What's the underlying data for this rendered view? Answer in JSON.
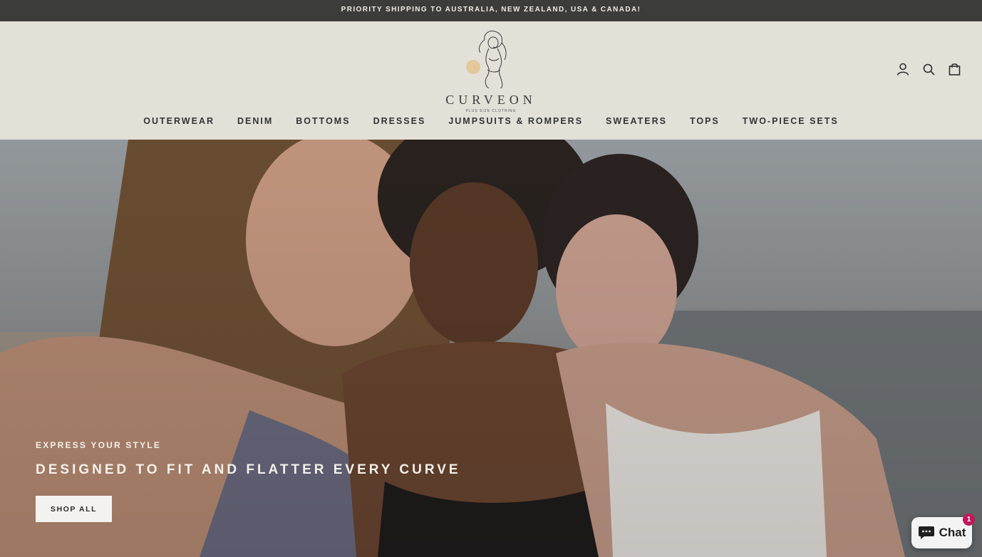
{
  "announcement": "PRIORITY SHIPPING TO AUSTRALIA, NEW ZEALAND, USA & CANADA!",
  "logo": {
    "word": "CURVEON",
    "tagline": "PLUS SIZE CLOTHING"
  },
  "header_icons": [
    "account-icon",
    "search-icon",
    "cart-icon"
  ],
  "nav": {
    "items": [
      {
        "label": "OUTERWEAR"
      },
      {
        "label": "DENIM"
      },
      {
        "label": "BOTTOMS"
      },
      {
        "label": "DRESSES"
      },
      {
        "label": "JUMPSUITS & ROMPERS"
      },
      {
        "label": "SWEATERS"
      },
      {
        "label": "TOPS"
      },
      {
        "label": "TWO-PIECE SETS"
      }
    ]
  },
  "hero": {
    "subtitle": "EXPRESS YOUR STYLE",
    "title": "DESIGNED TO FIT AND FLATTER EVERY CURVE",
    "button_label": "SHOP ALL",
    "image": "three-women-beach-photo"
  },
  "chat": {
    "label": "Chat",
    "badge": "1",
    "icon": "chat-bubble-icon"
  },
  "colors": {
    "announcement_bg": "#3c3c3b",
    "header_bg": "#e3e0d8",
    "chat_badge": "#c2185b"
  }
}
